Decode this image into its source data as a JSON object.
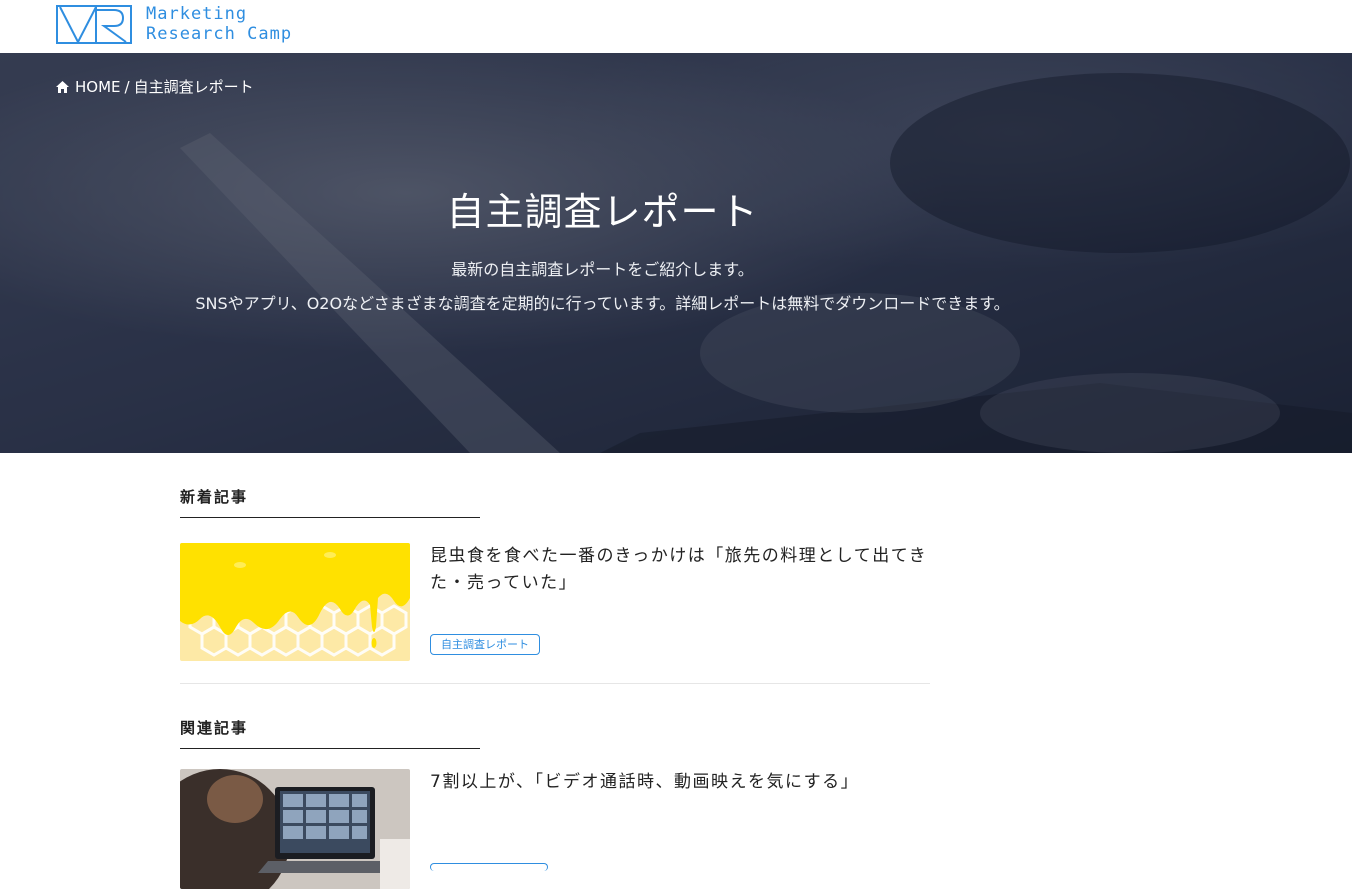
{
  "header": {
    "logo_line1": "Marketing",
    "logo_line2": "Research Camp",
    "brand_color": "#2f8ee0"
  },
  "hero": {
    "breadcrumb": {
      "home_icon": "home-icon",
      "home_label": "HOME",
      "separator": "/",
      "current": "自主調査レポート"
    },
    "title": "自主調査レポート",
    "description_line1": "最新の自主調査レポートをご紹介します。",
    "description_line2": "SNSやアプリ、O2Oなどさまざまな調査を定期的に行っています。詳細レポートは無料でダウンロードできます。"
  },
  "sections": {
    "new": {
      "heading": "新着記事",
      "articles": [
        {
          "title": "昆虫食を食べた一番のきっかけは「旅先の料理として出てきた・売っていた」",
          "tag": "自主調査レポート"
        }
      ]
    },
    "related": {
      "heading": "関連記事",
      "articles": [
        {
          "title": "7割以上が、「ビデオ通話時、動画映えを気にする」"
        }
      ]
    }
  }
}
